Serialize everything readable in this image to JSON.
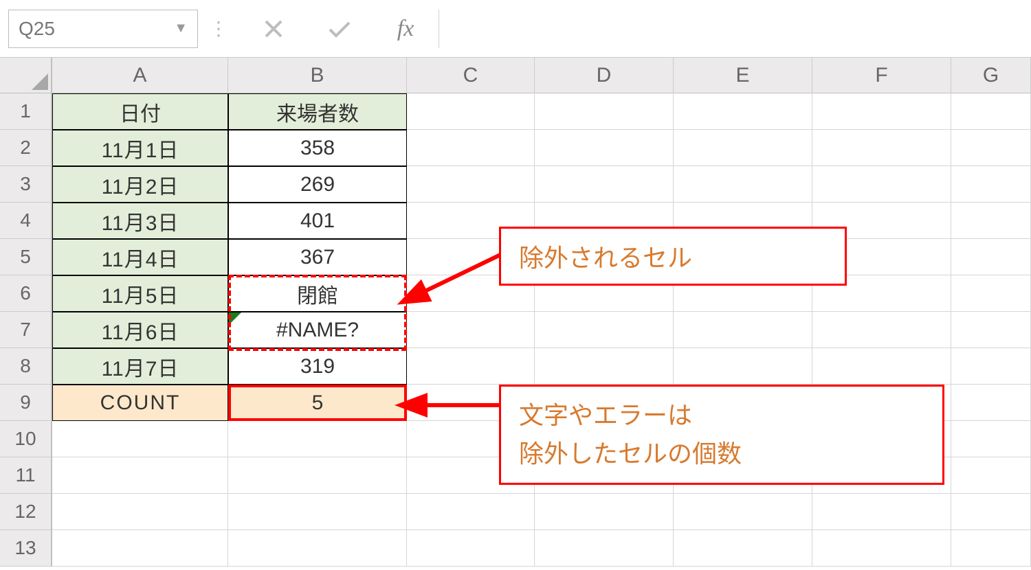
{
  "formula_bar": {
    "name_box": "Q25",
    "fx_label": "fx"
  },
  "columns": [
    "A",
    "B",
    "C",
    "D",
    "E",
    "F",
    "G"
  ],
  "row_numbers": [
    "1",
    "2",
    "3",
    "4",
    "5",
    "6",
    "7",
    "8",
    "9",
    "10",
    "11",
    "12",
    "13"
  ],
  "table": {
    "header_a": "日付",
    "header_b": "来場者数",
    "rows": [
      {
        "date": "11月1日",
        "value": "358"
      },
      {
        "date": "11月2日",
        "value": "269"
      },
      {
        "date": "11月3日",
        "value": "401"
      },
      {
        "date": "11月4日",
        "value": "367"
      },
      {
        "date": "11月5日",
        "value": "閉館"
      },
      {
        "date": "11月6日",
        "value": "#NAME?"
      },
      {
        "date": "11月7日",
        "value": "319"
      }
    ],
    "count_label": "COUNT",
    "count_value": "5"
  },
  "callouts": {
    "excluded": "除外されるセル",
    "desc_line1": "文字やエラーは",
    "desc_line2": "除外したセルの個数"
  },
  "colors": {
    "accent_red": "#ff0000",
    "callout_text": "#d77a2e",
    "date_bg": "#e2eed9",
    "count_bg": "#fde8cb"
  }
}
